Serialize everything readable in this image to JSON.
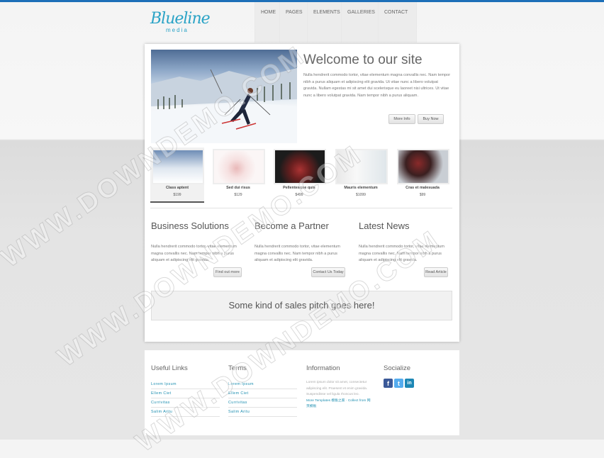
{
  "logo": {
    "script": "Blueline",
    "sub": "media"
  },
  "nav": [
    "HOME",
    "PAGES",
    "ELEMENTS",
    "GALLERIES",
    "CONTACT"
  ],
  "hero": {
    "title": "Welcome to our site",
    "text": "Nulla hendrerit commodo tortor, vitae elementum magna convallis nec. Nam tempor nibh a purus aliquam et adipiscing elit gravida. Ut vitae nunc a libero volutpat gravida. Nullam egestas mi sit amet dui scelerisque eu laoreet nisi ultrices. Ut vitae nunc a libero volutpat gravida. Nam tempor nibh a purus aliquam.",
    "more": "More Info",
    "buy": "Buy Now"
  },
  "thumbs": [
    {
      "name": "Class aptent",
      "price": "$199"
    },
    {
      "name": "Sed dui risus",
      "price": "$129"
    },
    {
      "name": "Pellentesque quis",
      "price": "$499"
    },
    {
      "name": "Mauris elementum",
      "price": "$1099"
    },
    {
      "name": "Cras et malesuada",
      "price": "$99"
    }
  ],
  "columns": [
    {
      "title": "Business Solutions",
      "text": "Nulla hendrerit commodo tortor, vitae elementum magna convallis nec. Nam tempor nibh a purus aliquam et adipiscing elit gravida.",
      "button": "Find out more"
    },
    {
      "title": "Become a Partner",
      "text": "Nulla hendrerit commodo tortor, vitae elementum magna convallis nec. Nam tempor nibh a purus aliquam et adipiscing elit gravida.",
      "button": "Contact Us Today"
    },
    {
      "title": "Latest News",
      "text": "Nulla hendrerit commodo tortor, vitae elementum magna convallis nec. Nam tempor nibh a purus aliquam et adipiscing elit gravida.",
      "button": "Read Article"
    }
  ],
  "pitch": "Some kind of sales pitch goes here!",
  "footer": {
    "useful_title": "Useful Links",
    "useful_links": [
      "Lorem Ipsum",
      "Ellem Ciet",
      "Currivitas",
      "Salim Aritu"
    ],
    "terms_title": "Terms",
    "terms_links": [
      "Lorem Ipsum",
      "Ellem Ciet",
      "Currivitas",
      "Salim Aritu"
    ],
    "info_title": "Information",
    "info_text": "Lorem ipsum dolor sit amet, consectetur adipiscing elit. Praesent et enim gravida. Suspendisse vel ligula rhoncus leo.",
    "info_more": "More Templates 模板之家 · Collect from 网页模板",
    "social_title": "Socialize",
    "socials": [
      {
        "name": "facebook-icon",
        "glyph": "f"
      },
      {
        "name": "twitter-icon",
        "glyph": "t"
      },
      {
        "name": "linkedin-icon",
        "glyph": "in"
      }
    ]
  },
  "watermark": "WWW.DOWNDEMO.COM",
  "colors": {
    "accent": "#2aa3c6",
    "link": "#1f8fb1",
    "topbar": "#1d6fb8"
  }
}
